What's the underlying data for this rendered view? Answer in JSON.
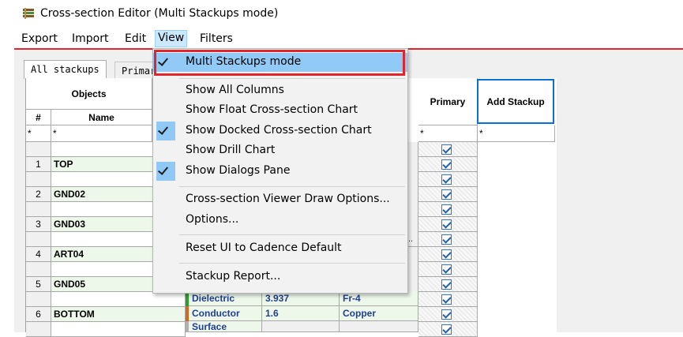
{
  "window": {
    "title": "Cross-section Editor (Multi Stackups mode)"
  },
  "menubar": {
    "items": [
      "Export",
      "Import",
      "Edit",
      "View",
      "Filters"
    ]
  },
  "tabs": [
    "All stackups",
    "Primar"
  ],
  "view_menu": {
    "items": [
      {
        "label": "Multi Stackups mode",
        "checked": true
      },
      {
        "label": "Show All Columns",
        "checked": false
      },
      {
        "label": "Show Float Cross-section Chart",
        "checked": false
      },
      {
        "label": "Show Docked Cross-section Chart",
        "checked": true
      },
      {
        "label": "Show Drill Chart",
        "checked": false
      },
      {
        "label": "Show Dialogs Pane",
        "checked": true
      },
      {
        "label": "Cross-section Viewer Draw Options...",
        "checked": false
      },
      {
        "label": "Options...",
        "checked": false
      },
      {
        "label": "Reset UI to Cadence Default",
        "checked": false
      },
      {
        "label": "Stackup Report...",
        "checked": false
      }
    ]
  },
  "grid": {
    "objects_header": "Objects",
    "number_header": "#",
    "name_header": "Name",
    "filter_symbol": "*",
    "primary_header": "Primary",
    "add_stackup": "Add Stackup",
    "ellipsis": "..",
    "layers": [
      {
        "num": "1",
        "name": "TOP"
      },
      {
        "num": "2",
        "name": "GND02"
      },
      {
        "num": "3",
        "name": "GND03"
      },
      {
        "num": "4",
        "name": "ART04"
      },
      {
        "num": "5",
        "name": "GND05"
      },
      {
        "num": "6",
        "name": "BOTTOM"
      }
    ],
    "detail_rows": [
      {
        "type": "Dielectric",
        "thickness": "3.937",
        "material": "Fr-4"
      },
      {
        "type": "Conductor",
        "thickness": "1.6",
        "material": "Copper"
      },
      {
        "type": "Surface",
        "thickness": "",
        "material": ""
      }
    ]
  },
  "colors": {
    "accent_red": "#e0252b",
    "menu_highlight": "#91c9f7",
    "dielectric": "#2ca02c",
    "conductor": "#d2691e",
    "surface": "#b0b0b0"
  }
}
